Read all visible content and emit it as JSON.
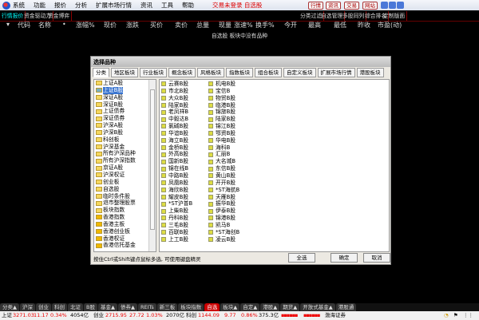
{
  "menubar": {
    "items": [
      "系统",
      "功能",
      "报价",
      "分析",
      "扩展市场行情",
      "资讯",
      "工具",
      "帮助"
    ],
    "login": "交易未登录 自选股",
    "buttons": [
      "行情",
      "资讯",
      "交易",
      "网站"
    ]
  },
  "toolbar": {
    "left_tabs": [
      "行情报价",
      "资金驱动力",
      "资金博弈"
    ],
    "right_tabs": [
      "分类过滤",
      "自选管理",
      "多股同列",
      "综合排名",
      "定制版面"
    ]
  },
  "columns": [
    "代码",
    "名称",
    "•",
    "涨幅%",
    "现价",
    "涨跌",
    "买价",
    "卖价",
    "总量",
    "现量",
    "涨速%",
    "换手%",
    "今开",
    "最高",
    "最低",
    "昨收",
    "市盈(动)"
  ],
  "message": "自选股 板块中没有品种",
  "dialog": {
    "title": "选择品种",
    "tabs": [
      "分类",
      "地区板块",
      "行业板块",
      "概念板块",
      "风格板块",
      "指数板块",
      "组合板块",
      "自定义板块",
      "扩展市场行情",
      "港股板块"
    ],
    "categories": [
      "上证A股",
      "上证B股",
      "深证A股",
      "深证B股",
      "上证债券",
      "深证债券",
      "沪深A股",
      "沪深B股",
      "科创板",
      "沪深基金",
      "所有沪深品种",
      "所有沪深指数",
      "京证A股",
      "沪深权证",
      "创业板",
      "自选股",
      "临时条件股",
      "退市整理股票",
      "板块指数",
      "香港指数",
      "香港主板",
      "香港创业板",
      "香港权证",
      "香港信托基金"
    ],
    "selected_category": "上证B股",
    "stocks_col1": [
      "云赛B股",
      "市北B股",
      "大众B股",
      "陆家B股",
      "老凤祥B",
      "中毅达B",
      "氯碱B股",
      "华谊B股",
      "海立B股",
      "金桥B股",
      "外高B股",
      "国新B股",
      "锦在线B",
      "中路B股",
      "凤凰B股",
      "海欣B股",
      "耀皮B股",
      "*ST沪普B",
      "上柴B股",
      "丹科B股",
      "三毛B股",
      "百联B股",
      "上工B股"
    ],
    "stocks_col2": [
      "机电B股",
      "宝信B",
      "物贸B股",
      "临港B股",
      "锦旅B股",
      "陆家B股",
      "锦江B股",
      "鄂资B股",
      "华电B股",
      "海科B",
      "汇丽B",
      "大名城B",
      "东信B股",
      "黄山B股",
      "开开B股",
      "*ST海航B",
      "天雁B股",
      "振华B股",
      "伊泰B股",
      "锦港B股",
      "凯马B",
      "*ST海创B",
      "凌云B股"
    ],
    "hint": "按住Ctrl或Shift键点鼠标多选, 可使用键盘精灵",
    "buttons": {
      "select_all": "全选",
      "ok": "确定",
      "cancel": "取消"
    }
  },
  "bottom_tabs": [
    "分类▲",
    "沪深",
    "创业",
    "科创",
    "北证",
    "B股",
    "基金▲",
    "债券▲",
    "REITs",
    "新三板",
    "板块指数",
    "自选",
    "板块▲",
    "自定▲",
    "港股▲",
    "期货▲",
    "开放式基金▲",
    "港股通"
  ],
  "active_bottom_tab": "自选",
  "status": {
    "sh_label": "上证",
    "sh_value": "3271.03",
    "sh_change": "11.17",
    "sh_pct": "0.34%",
    "sh_amount": "4054亿",
    "cy_label": "创业",
    "cy_value": "2715.95",
    "cy_change": "27.72",
    "cy_pct": "1.03%",
    "cy_amount": "2070亿",
    "kc_label": "科创",
    "kc_value": "1144.09",
    "kc_change": "9.77",
    "kc_pct": "0.86%",
    "kc_amount": "375.3亿",
    "broker": "渤海证券"
  }
}
